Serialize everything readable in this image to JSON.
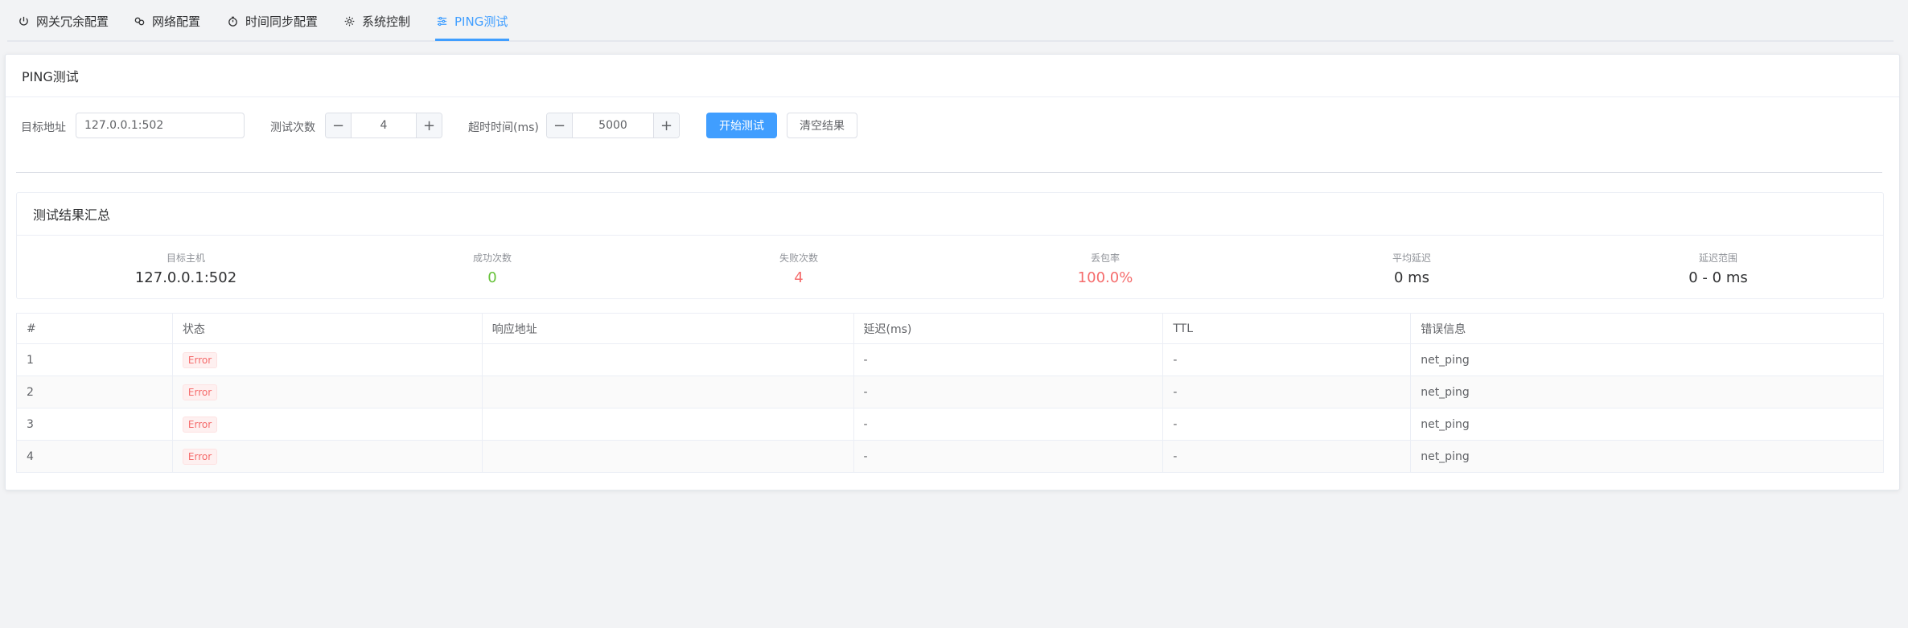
{
  "tabs": [
    {
      "label": "网关冗余配置",
      "icon": "power-icon"
    },
    {
      "label": "网络配置",
      "icon": "link-icon"
    },
    {
      "label": "时间同步配置",
      "icon": "stopwatch-icon"
    },
    {
      "label": "系统控制",
      "icon": "gear-icon"
    },
    {
      "label": "PING测试",
      "icon": "sliders-icon",
      "active": true
    }
  ],
  "card": {
    "title": "PING测试"
  },
  "form": {
    "target_label": "目标地址",
    "target_value": "127.0.0.1:502",
    "count_label": "测试次数",
    "count_value": "4",
    "timeout_label": "超时时间(ms)",
    "timeout_value": "5000",
    "minus": "−",
    "plus": "+",
    "start_button": "开始测试",
    "clear_button": "清空结果"
  },
  "summary": {
    "title": "测试结果汇总",
    "stats": [
      {
        "label": "目标主机",
        "value": "127.0.0.1:502",
        "color": "#303133"
      },
      {
        "label": "成功次数",
        "value": "0",
        "color": "#67c23a"
      },
      {
        "label": "失败次数",
        "value": "4",
        "color": "#f56c6c"
      },
      {
        "label": "丢包率",
        "value": "100.0%",
        "color": "#f56c6c"
      },
      {
        "label": "平均延迟",
        "value": "0 ms",
        "color": "#303133"
      },
      {
        "label": "延迟范围",
        "value": "0 - 0 ms",
        "color": "#303133"
      }
    ]
  },
  "table": {
    "columns": [
      "#",
      "状态",
      "响应地址",
      "延迟(ms)",
      "TTL",
      "错误信息"
    ],
    "rows": [
      {
        "n": "1",
        "status": "Error",
        "addr": "",
        "latency": "-",
        "ttl": "-",
        "err": "net_ping"
      },
      {
        "n": "2",
        "status": "Error",
        "addr": "",
        "latency": "-",
        "ttl": "-",
        "err": "net_ping"
      },
      {
        "n": "3",
        "status": "Error",
        "addr": "",
        "latency": "-",
        "ttl": "-",
        "err": "net_ping"
      },
      {
        "n": "4",
        "status": "Error",
        "addr": "",
        "latency": "-",
        "ttl": "-",
        "err": "net_ping"
      }
    ]
  },
  "colors": {
    "accent": "#409eff",
    "success": "#67c23a",
    "danger": "#f56c6c"
  }
}
